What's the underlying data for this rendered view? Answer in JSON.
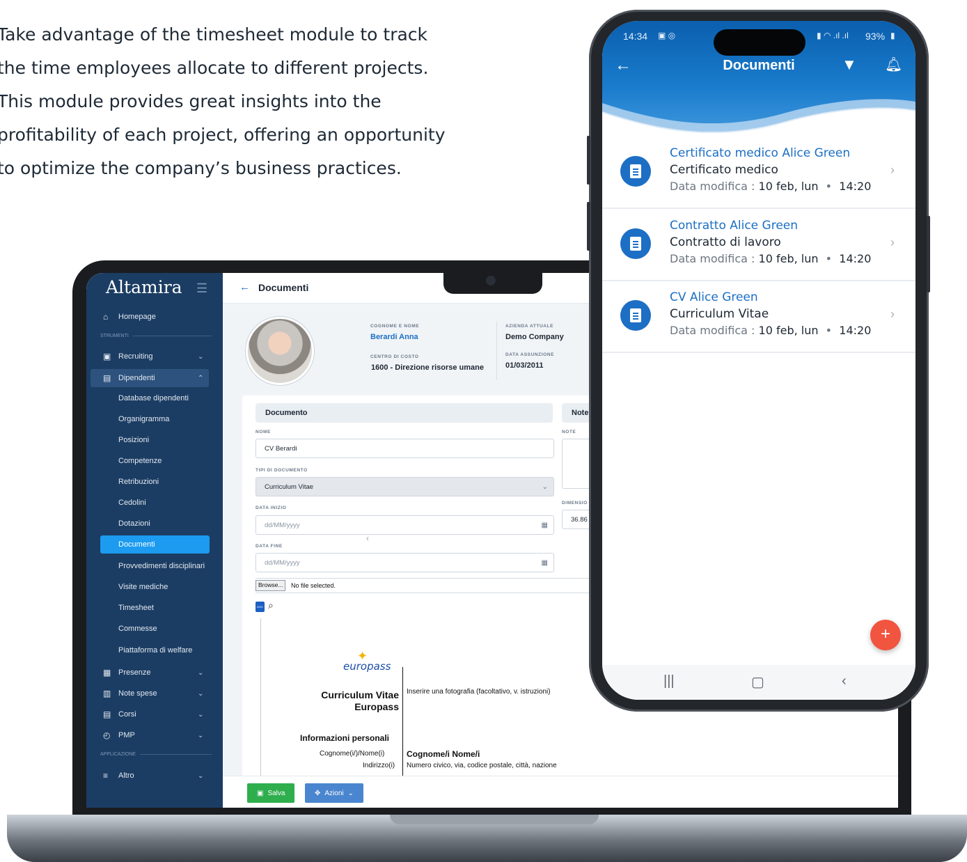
{
  "intro": {
    "line1": "Take advantage of the timesheet module to track",
    "line2": "the time employees allocate to different projects.",
    "line3": "This module provides great insights into the",
    "line4": "profitability of each project, offering an opportunity",
    "line5": "to optimize the company’s business practices."
  },
  "desktop": {
    "brand": "Altamira",
    "sidebar": {
      "homepage": "Homepage",
      "section_tools": "STRUMENTI",
      "recruiting": "Recruiting",
      "dipendenti": "Dipendenti",
      "sub_items": [
        "Database dipendenti",
        "Organigramma",
        "Posizioni",
        "Competenze",
        "Retribuzioni",
        "Cedolini",
        "Dotazioni",
        "Documenti",
        "Provvedimenti disciplinari",
        "Visite mediche",
        "Timesheet",
        "Commesse",
        "Piattaforma di welfare"
      ],
      "presenze": "Presenze",
      "note_spese": "Note spese",
      "corsi": "Corsi",
      "pmp": "PMP",
      "section_app": "APPLICAZIONE",
      "altro": "Altro"
    },
    "header": {
      "title": "Documenti"
    },
    "employee": {
      "name_label": "COGNOME E NOME",
      "name": "Berardi Anna",
      "company_label": "AZIENDA ATTUALE",
      "company": "Demo Company",
      "cost_center_label": "CENTRO DI COSTO",
      "cost_center": "1600 - Direzione risorse umane",
      "hire_date_label": "DATA ASSUNZIONE",
      "hire_date": "01/03/2011"
    },
    "form": {
      "tab_document": "Documento",
      "tab_notes": "Note",
      "nome_label": "NOME",
      "nome_value": "CV Berardi",
      "tipo_label": "TIPI DI DOCUMENTO",
      "tipo_value": "Curriculum Vitae",
      "inizio_label": "DATA INIZIO",
      "inizio_placeholder": "dd/MM/yyyy",
      "fine_label": "DATA FINE",
      "fine_placeholder": "dd/MM/yyyy",
      "note_label": "NOTE",
      "dim_label": "DIMENSIO",
      "dim_value": "36.86",
      "browse": "Browse...",
      "no_file": "No file selected."
    },
    "cv": {
      "logo": "europass",
      "title_line1": "Curriculum Vitae",
      "title_line2": "Europass",
      "photo_hint": "Inserire una fotografia (facoltativo, v. istruzioni)",
      "section": "Informazioni personali",
      "name_label": "Cognome(i/)/Nome(i)",
      "name_value": "Cognome/i Nome/i",
      "address_label": "Indirizzo(i)",
      "address_value": "Numero civico, via, codice postale, città, nazione"
    },
    "actions": {
      "save": "Salva",
      "actions": "Azioni"
    }
  },
  "mobile": {
    "status_time": "14:34",
    "status_battery": "93%",
    "title": "Documenti",
    "documents": [
      {
        "name": "Certificato medico Alice Green",
        "type": "Certificato medico",
        "meta_label": "Data modifica :",
        "date": "10 feb, lun",
        "time": "14:20"
      },
      {
        "name": "Contratto Alice Green",
        "type": "Contratto di lavoro",
        "meta_label": "Data modifica :",
        "date": "10 feb, lun",
        "time": "14:20"
      },
      {
        "name": "CV Alice Green",
        "type": "Curriculum Vitae",
        "meta_label": "Data modifica :",
        "date": "10 feb, lun",
        "time": "14:20"
      }
    ],
    "fab": "+"
  },
  "colors": {
    "sidebar": "#1c3d63",
    "accent": "#1c9bf0",
    "link": "#1c6fc4",
    "save": "#2fae4e",
    "fab": "#f1543f"
  }
}
